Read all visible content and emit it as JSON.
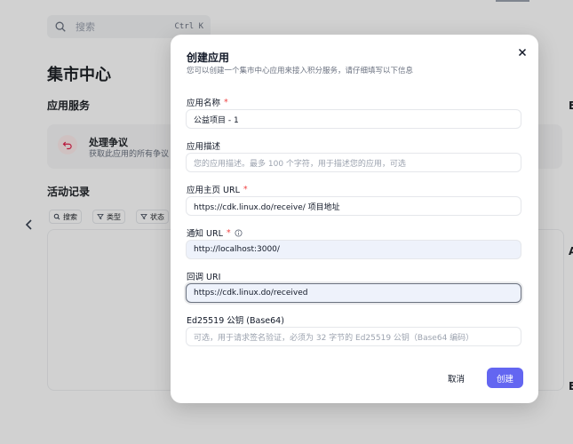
{
  "search": {
    "placeholder": "搜索",
    "shortcut": "Ctrl K"
  },
  "page": {
    "title": "集市中心",
    "services_title": "应用服务",
    "service_card": {
      "title": "处理争议",
      "desc": "获取此应用的所有争议"
    },
    "activity_title": "活动记录",
    "filters": [
      {
        "label": "搜索",
        "icon": "search-icon"
      },
      {
        "label": "类型",
        "icon": "filter-icon"
      },
      {
        "label": "状态",
        "icon": "filter-icon"
      }
    ],
    "right_fragments": [
      "E",
      "A",
      "E"
    ]
  },
  "modal": {
    "title": "创建应用",
    "subtitle": "您可以创建一个集市中心应用来接入积分服务，请仔细填写以下信息",
    "fields": [
      {
        "label": "应用名称",
        "required": true,
        "value": "公益项目 - 1",
        "placeholder": ""
      },
      {
        "label": "应用描述",
        "required": false,
        "value": "",
        "placeholder": "您的应用描述。最多 100 个字符，用于描述您的应用，可选"
      },
      {
        "label": "应用主页 URL",
        "required": true,
        "value": "https://cdk.linux.do/receive/  项目地址",
        "placeholder": ""
      },
      {
        "label": "通知 URL",
        "required": true,
        "info": true,
        "value": "http://localhost:3000/",
        "placeholder": ""
      },
      {
        "label": "回调 URI",
        "required": false,
        "value": "https://cdk.linux.do/received",
        "placeholder": ""
      },
      {
        "label": "Ed25519 公钥 (Base64)",
        "required": false,
        "value": "",
        "placeholder": "可选，用于请求签名验证，必须为 32 字节的 Ed25519 公钥（Base64 编码）"
      }
    ],
    "cancel_label": "取消",
    "create_label": "创建"
  },
  "colors": {
    "accent": "#6366f1",
    "required": "#ef4444",
    "overlay": "rgba(0,0,0,0.18)"
  }
}
